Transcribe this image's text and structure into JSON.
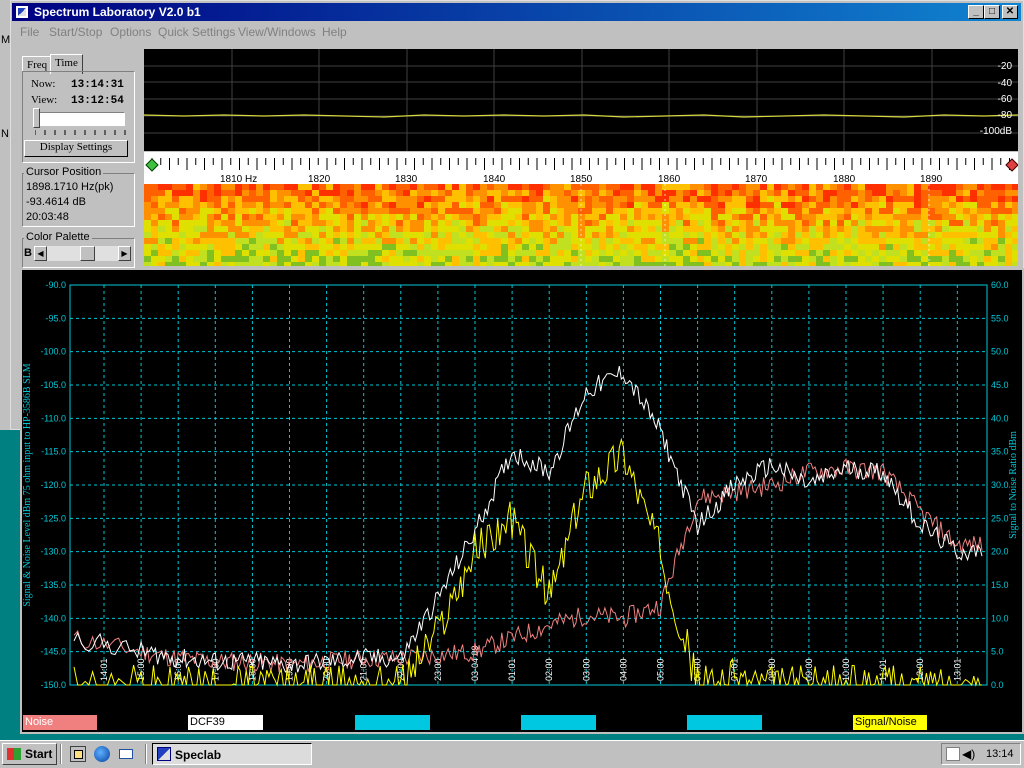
{
  "window": {
    "title": "Spectrum Laboratory V2.0 b1",
    "minimize": "_",
    "maximize": "□",
    "close": "✕"
  },
  "left_strip": [
    "M",
    "N"
  ],
  "menu": [
    "File",
    "Start/Stop",
    "Options",
    "Quick Settings",
    "View/Windows",
    "Help"
  ],
  "panel": {
    "tab_freq": "Freq",
    "tab_time": "Time",
    "now_label": "Now:",
    "now_value": "13:14:31",
    "view_label": "View:",
    "view_value": "13:12:54",
    "display_settings": "Display Settings",
    "cursor_title": "Cursor Position",
    "cursor_freq": "1898.1710 Hz(pk)",
    "cursor_db": "-93.4614 dB",
    "cursor_time": "20:03:48",
    "palette_title": "Color Palette",
    "palette_b": "B"
  },
  "spectrum": {
    "db_labels": [
      "-20",
      "-40",
      "-60",
      "-80",
      "-100dB"
    ],
    "freq_labels": [
      "1810 Hz",
      "1820",
      "1830",
      "1840",
      "1850",
      "1860",
      "1870",
      "1880",
      "1890"
    ]
  },
  "plot": {
    "left_axis_title": "Signal & Noise Level dBm 75 ohm input to HP-3586B SLM",
    "right_axis_title": "Signal to Noise Ratio  dBm",
    "left_ticks": [
      "-90.0",
      "-95.0",
      "-100.0",
      "-105.0",
      "-110.0",
      "-115.0",
      "-120.0",
      "-125.0",
      "-130.0",
      "-135.0",
      "-140.0",
      "-145.0",
      "-150.0"
    ],
    "right_ticks": [
      "60.0",
      "55.0",
      "50.0",
      "45.0",
      "40.0",
      "35.0",
      "30.0",
      "25.0",
      "20.0",
      "15.0",
      "10.0",
      "5.0",
      "0.0"
    ],
    "time_ticks": [
      "14:01",
      "15:00",
      "16:00",
      "17:00",
      "18:00",
      "19:00",
      "20:00",
      "21:00",
      "22:00",
      "23:00",
      "03-04 09",
      "01:01",
      "02:00",
      "03:00",
      "04:00",
      "05:00",
      "06:00",
      "07:01",
      "08:00",
      "09:00",
      "10:00",
      "11:01",
      "12:00",
      "13:01"
    ],
    "colors": {
      "noise": "#f08080",
      "signal": "#ffffff",
      "snr": "#ffff00",
      "grid": "#00c8d8",
      "axis_text": "#00c8d8"
    }
  },
  "legend": {
    "noise": "Noise",
    "dcf39": "DCF39",
    "snr": "Signal/Noise"
  },
  "chart_data": {
    "type": "line",
    "title": "",
    "xlabel": "",
    "ylabel": "Signal & Noise Level dBm 75 ohm input to HP-3586B SLM",
    "y2label": "Signal to Noise Ratio  dBm",
    "ylim": [
      -150,
      -90
    ],
    "y2lim": [
      0,
      60
    ],
    "grid": true,
    "categories": [
      "14:01",
      "15:00",
      "16:00",
      "17:00",
      "18:00",
      "19:00",
      "20:00",
      "21:00",
      "22:00",
      "23:00",
      "03-04 09",
      "01:01",
      "02:00",
      "03:00",
      "04:00",
      "05:00",
      "06:00",
      "07:01",
      "08:00",
      "09:00",
      "10:00",
      "11:01",
      "12:00",
      "13:01"
    ],
    "series": [
      {
        "name": "Noise",
        "axis": "left",
        "values": [
          -143,
          -145,
          -146,
          -146.5,
          -146.5,
          -147,
          -146.5,
          -146,
          -146,
          -145.5,
          -145,
          -143,
          -141,
          -139.5,
          -140,
          -138,
          -122,
          -121,
          -120,
          -118,
          -117.5,
          -118,
          -124,
          -129
        ]
      },
      {
        "name": "DCF39",
        "axis": "left",
        "values": [
          -143,
          -145,
          -146,
          -146.5,
          -146.5,
          -147,
          -146.5,
          -146,
          -146,
          -137,
          -127,
          -115,
          -118,
          -106,
          -103,
          -112,
          -126,
          -120,
          -117,
          -120,
          -117.5,
          -118,
          -126,
          -130
        ]
      },
      {
        "name": "Signal/Noise",
        "axis": "right",
        "values": [
          0,
          0,
          0,
          0,
          0,
          0,
          0,
          0,
          0,
          8,
          20,
          25,
          13,
          30,
          35,
          20,
          0,
          1,
          0,
          0,
          0,
          0,
          0,
          0
        ]
      }
    ]
  },
  "taskbar": {
    "start": "Start",
    "task": "Speclab",
    "clock": "13:14"
  }
}
